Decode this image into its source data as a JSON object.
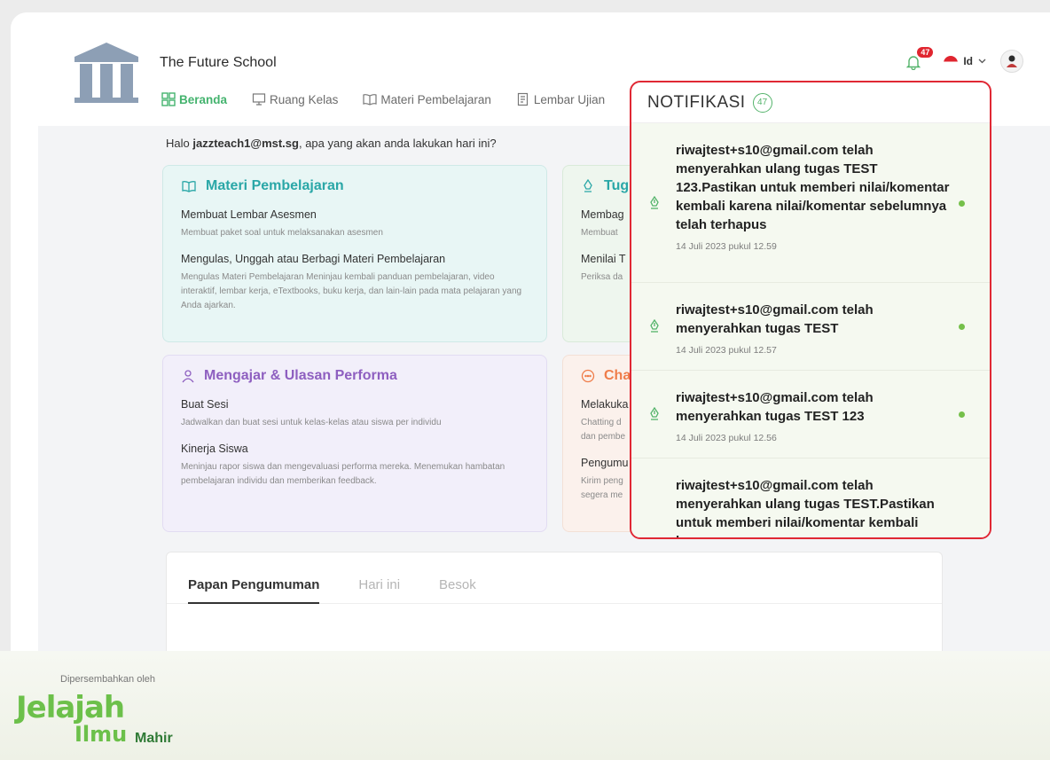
{
  "school": {
    "name": "The Future School"
  },
  "nav": {
    "items": [
      {
        "label": "Beranda",
        "icon": "grid-icon",
        "active": true
      },
      {
        "label": "Ruang Kelas",
        "icon": "monitor-icon"
      },
      {
        "label": "Materi Pembelajaran",
        "icon": "book-icon"
      },
      {
        "label": "Lembar Ujian",
        "icon": "document-icon"
      }
    ]
  },
  "header": {
    "bell_count": "47",
    "language": "Id"
  },
  "greeting": {
    "prefix": "Halo ",
    "user": "jazzteach1@mst.sg",
    "suffix": ", apa yang akan anda lakukan hari ini?"
  },
  "cards": {
    "materi": {
      "title": "Materi Pembelajaran",
      "items": [
        {
          "title": "Membuat Lembar Asesmen",
          "desc": "Membuat paket soal untuk melaksanakan asesmen"
        },
        {
          "title": "Mengulas, Unggah atau Berbagi Materi Pembelajaran",
          "desc": "Mengulas Materi Pembelajaran Meninjau kembali panduan pembelajaran, video interaktif, lembar kerja, eTextbooks, buku kerja, dan lain-lain pada mata pelajaran yang Anda ajarkan."
        }
      ]
    },
    "tugas": {
      "title": "Tug",
      "items": [
        {
          "title": "Membag",
          "desc": "Membuat"
        },
        {
          "title": "Menilai T",
          "desc": "Periksa da"
        }
      ]
    },
    "mengajar": {
      "title": "Mengajar & Ulasan Performa",
      "items": [
        {
          "title": "Buat Sesi",
          "desc": "Jadwalkan dan buat sesi untuk kelas-kelas atau siswa per individu"
        },
        {
          "title": "Kinerja Siswa",
          "desc": "Meninjau rapor siswa dan mengevaluasi performa mereka. Menemukan hambatan pembelajaran individu dan memberikan feedback."
        }
      ]
    },
    "chat": {
      "title": "Cha",
      "items": [
        {
          "title": "Melakuka",
          "desc": "Chatting d\ndan pembe"
        },
        {
          "title": "Pengumu",
          "desc": "Kirim peng\nsegera me"
        }
      ]
    }
  },
  "announcements": {
    "tabs": [
      {
        "label": "Papan Pengumuman",
        "active": true
      },
      {
        "label": "Hari ini"
      },
      {
        "label": "Besok"
      }
    ]
  },
  "footer": {
    "powered_by": "Dipersembahkan oleh",
    "brand_1": "Jelajah",
    "brand_2": "Ilmu",
    "brand_3": "Mahir"
  },
  "notifications": {
    "title": "NOTIFIKASI",
    "count": "47",
    "items": [
      {
        "message": "riwajtest+s10@gmail.com telah menyerahkan ulang tugas TEST 123.Pastikan untuk memberi nilai/komentar kembali karena nilai/komentar sebelumnya telah terhapus",
        "time": "14 Juli 2023 pukul 12.59"
      },
      {
        "message": "riwajtest+s10@gmail.com telah menyerahkan tugas TEST",
        "time": "14 Juli 2023 pukul 12.57"
      },
      {
        "message": "riwajtest+s10@gmail.com telah menyerahkan tugas TEST 123",
        "time": "14 Juli 2023 pukul 12.56"
      },
      {
        "message": "riwajtest+s10@gmail.com telah menyerahkan ulang tugas TEST.Pastikan untuk memberi nilai/komentar kembali karena",
        "time": ""
      }
    ]
  },
  "colors": {
    "accent_green": "#44b36e",
    "highlight_red": "#e02834",
    "teal": "#2aa7a7",
    "purple": "#8e5fc0",
    "orange": "#ef7d4a"
  }
}
